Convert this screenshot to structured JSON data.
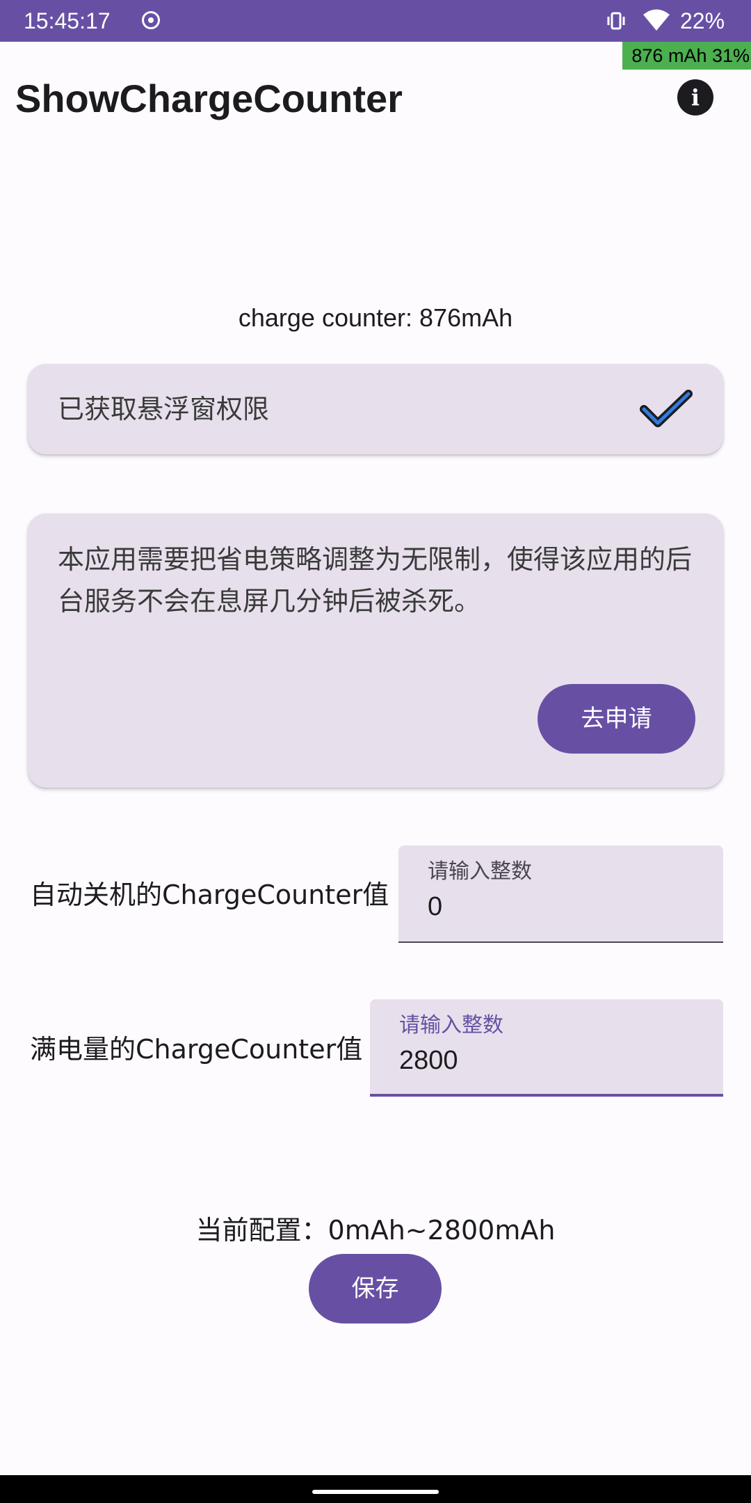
{
  "status_bar": {
    "time": "15:45:17",
    "battery": "22%",
    "icons": [
      "screen-record-icon",
      "vibrate-icon",
      "wifi-icon"
    ],
    "color": "#6750A4"
  },
  "overlay": {
    "text": "876 mAh 31%",
    "color": "#4CAF50"
  },
  "app_bar": {
    "title": "ShowChargeCounter",
    "info_icon": "info-icon",
    "info_glyph": "i"
  },
  "main": {
    "charge_counter": "charge counter: 876mAh",
    "permission_card": {
      "text": "已获取悬浮窗权限",
      "icon": "checkmark-icon"
    },
    "battery_card": {
      "text": "本应用需要把省电策略调整为无限制，使得该应用的后台服务不会在息屏几分钟后被杀死。",
      "button": "去申请"
    },
    "shutdown_row": {
      "label": "自动关机的ChargeCounter值",
      "field_label": "请输入整数",
      "value": "0"
    },
    "full_row": {
      "label": "满电量的ChargeCounter值",
      "field_label": "请输入整数",
      "value": "2800"
    },
    "current_config": "当前配置：0mAh~2800mAh",
    "save_button": "保存"
  },
  "colors": {
    "primary": "#6750A4",
    "card": "#E7E0EC",
    "background": "#FEFBFF",
    "check_blue": "#2F7DE1"
  }
}
